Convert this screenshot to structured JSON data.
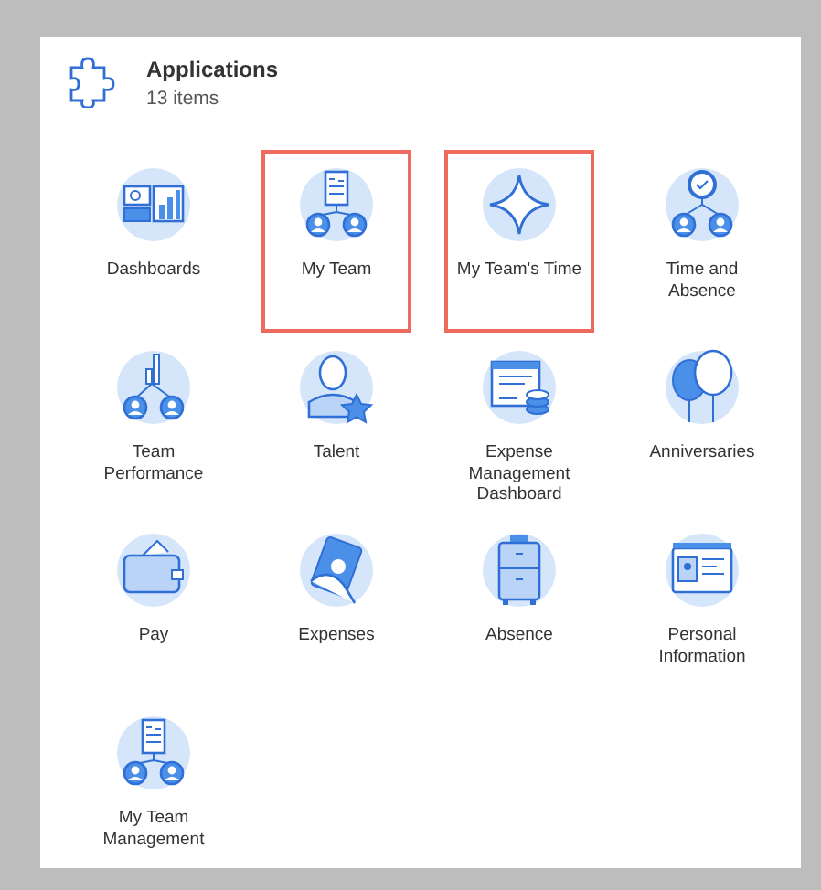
{
  "header": {
    "title": "Applications",
    "count": "13 items"
  },
  "apps": [
    {
      "label": "Dashboards",
      "kind": "dashboard",
      "highlighted": false
    },
    {
      "label": "My Team",
      "kind": "team",
      "highlighted": true
    },
    {
      "label": "My Team's Time",
      "kind": "sparkle",
      "highlighted": true
    },
    {
      "label": "Time and Absence",
      "kind": "clockteam",
      "highlighted": false
    },
    {
      "label": "Team Performance",
      "kind": "performance",
      "highlighted": false
    },
    {
      "label": "Talent",
      "kind": "talent",
      "highlighted": false
    },
    {
      "label": "Expense Management Dashboard",
      "kind": "expensedash",
      "highlighted": false
    },
    {
      "label": "Anniversaries",
      "kind": "balloons",
      "highlighted": false
    },
    {
      "label": "Pay",
      "kind": "wallet",
      "highlighted": false
    },
    {
      "label": "Expenses",
      "kind": "cash",
      "highlighted": false
    },
    {
      "label": "Absence",
      "kind": "suitcase",
      "highlighted": false
    },
    {
      "label": "Personal Information",
      "kind": "idcard",
      "highlighted": false
    },
    {
      "label": "My Team Management",
      "kind": "team",
      "highlighted": false
    }
  ]
}
